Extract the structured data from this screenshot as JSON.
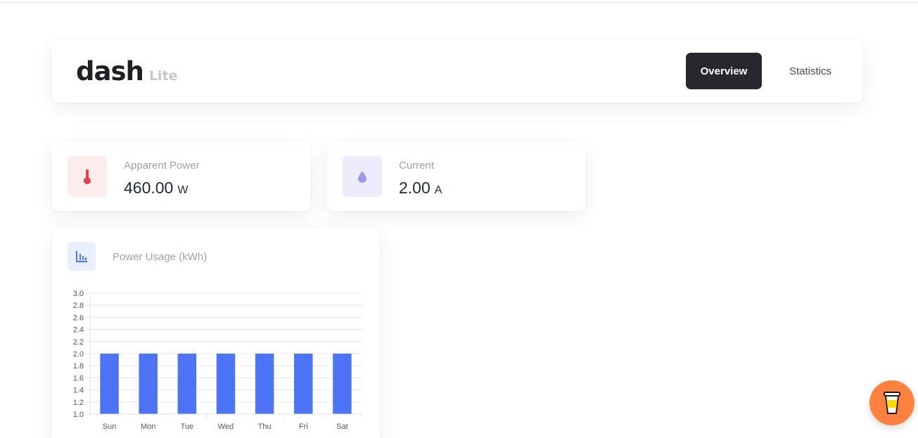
{
  "brand": {
    "name": "dash",
    "suffix": "Lite"
  },
  "nav": {
    "overview_label": "Overview",
    "statistics_label": "Statistics"
  },
  "cards": {
    "power": {
      "label": "Apparent Power",
      "value": "460.00",
      "unit": "W",
      "icon": "thermometer-icon",
      "color": "#e0414f"
    },
    "current": {
      "label": "Current",
      "value": "2.00",
      "unit": "A",
      "icon": "water-drop-icon",
      "color": "#9d9bf0"
    }
  },
  "usage_chart": {
    "title": "Power Usage (kWh)",
    "icon": "bar-chart-icon"
  },
  "coffee": {
    "icon": "coffee-cup-icon",
    "color": "#ff813f"
  },
  "chart_data": {
    "type": "bar",
    "categories": [
      "Sun",
      "Mon",
      "Tue",
      "Wed",
      "Thu",
      "Fri",
      "Sat"
    ],
    "values": [
      2.0,
      2.0,
      2.0,
      2.0,
      2.0,
      2.0,
      2.0
    ],
    "ylim": [
      1.0,
      3.0
    ],
    "yticks": [
      "1.0",
      "1.2",
      "1.4",
      "1.6",
      "1.8",
      "2.0",
      "2.2",
      "2.4",
      "2.6",
      "2.8",
      "3.0"
    ],
    "grid": true,
    "bar_color": "#4c74f5"
  }
}
